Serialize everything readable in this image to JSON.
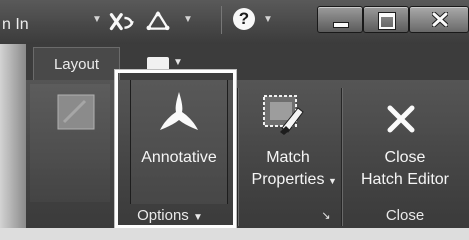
{
  "titlebar": {
    "signin_text": "n In",
    "help_symbol": "?",
    "dropdown_symbol": "▼",
    "window_controls": [
      "minimize",
      "restore",
      "close"
    ]
  },
  "ribbon": {
    "tabs": [
      {
        "label": "Layout"
      }
    ],
    "buttons": [
      {
        "name": "annotative",
        "label": "Annotative",
        "icon": "annotation-scale-icon"
      },
      {
        "name": "match-properties",
        "label_line1": "Match",
        "label_line2": "Properties",
        "icon": "match-properties-icon"
      },
      {
        "name": "close-hatch-editor",
        "label_line1": "Close",
        "label_line2": "Hatch Editor",
        "icon": "close-x-icon"
      }
    ],
    "panels": {
      "options": {
        "label": "Options",
        "arrow": "▼",
        "launcher": "↘"
      },
      "close": {
        "label": "Close"
      }
    }
  },
  "colors": {
    "accent_frame": "#f7f7f7",
    "panel_bg": "#4a4a4a",
    "text": "#efefef"
  }
}
